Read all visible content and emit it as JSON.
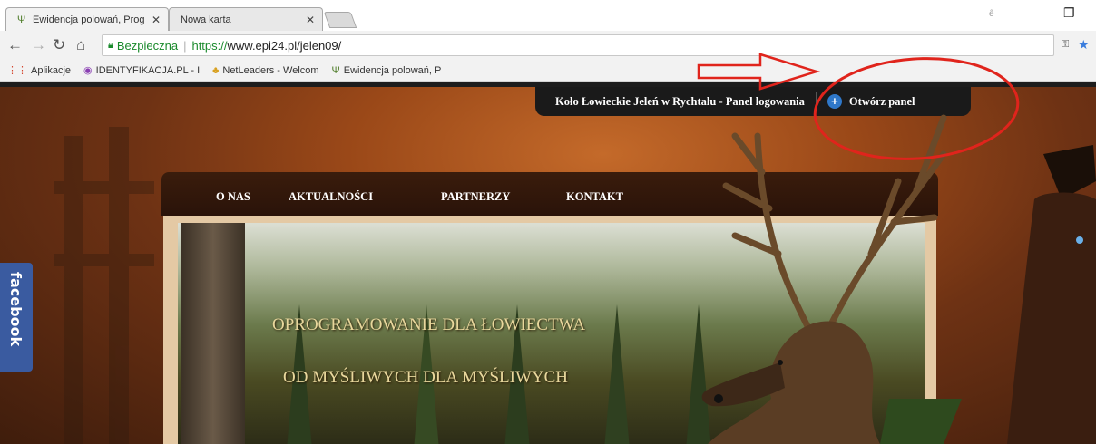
{
  "browser": {
    "tabs": [
      {
        "title": "Ewidencja polowań, Prog",
        "active": true
      },
      {
        "title": "Nowa karta",
        "active": false
      }
    ],
    "address": {
      "security_label": "Bezpieczna",
      "url_protocol": "https://",
      "url_rest": "www.epi24.pl/jelen09/"
    },
    "bookmarks": [
      {
        "label": "Aplikacje",
        "icon": "apps-grid-icon"
      },
      {
        "label": "IDENTYFIKACJA.PL - I",
        "icon": "identyfikacja-icon"
      },
      {
        "label": "NetLeaders - Welcom",
        "icon": "netleaders-icon"
      },
      {
        "label": "Ewidencja polowań, P",
        "icon": "antler-icon"
      }
    ]
  },
  "page": {
    "login_bar": {
      "title": "Koło Łowieckie Jeleń w Rychtalu - Panel logowania",
      "open_panel": "Otwórz panel"
    },
    "menu": [
      "O NAS",
      "AKTUALNOŚCI",
      "PARTNERZY",
      "KONTAKT"
    ],
    "slogan": [
      "OPROGRAMOWANIE DLA ŁOWIECTWA",
      "OD MYŚLIWYCH DLA MYŚLIWYCH"
    ],
    "facebook_tab": "facebook"
  },
  "annotation_color": "#e0241c"
}
